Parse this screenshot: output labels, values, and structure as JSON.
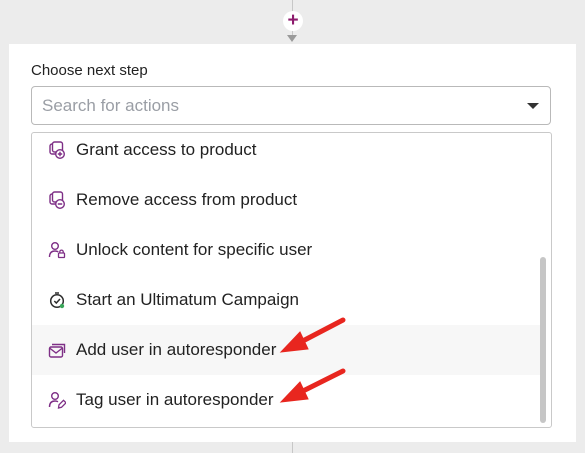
{
  "flow": {
    "add_step_symbol": "+"
  },
  "step_picker": {
    "label": "Choose next step",
    "search_placeholder": "Search for actions",
    "options": [
      {
        "label": "Grant access to product",
        "icon": "product-grant-icon"
      },
      {
        "label": "Remove access from product",
        "icon": "product-remove-icon"
      },
      {
        "label": "Unlock content for specific user",
        "icon": "user-lock-icon"
      },
      {
        "label": "Start an Ultimatum Campaign",
        "icon": "timer-icon"
      },
      {
        "label": "Add user in autoresponder",
        "icon": "autoresponder-add-icon"
      },
      {
        "label": "Tag user in autoresponder",
        "icon": "autoresponder-tag-icon"
      }
    ]
  },
  "colors": {
    "accent": "#8d1b6d",
    "icon": "#7e2f86",
    "annotation_arrow": "#e8261f",
    "hover_row": "#f7f7f7"
  }
}
